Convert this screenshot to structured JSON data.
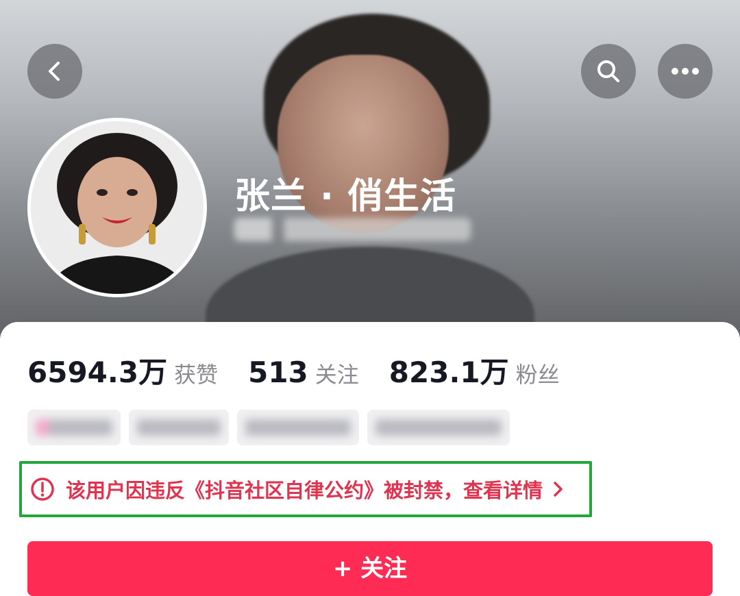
{
  "profile": {
    "name": "张兰 · 俏生活",
    "avatar_icon": "person-avatar"
  },
  "stats": [
    {
      "value": "6594.3万",
      "label": "获赞"
    },
    {
      "value": "513",
      "label": "关注"
    },
    {
      "value": "823.1万",
      "label": "粉丝"
    }
  ],
  "notice": {
    "text": "该用户因违反《抖音社区自律公约》被封禁，查看详情",
    "icon": "alert-circle-icon",
    "color": "#e0334f",
    "highlight_color": "#22a83a"
  },
  "actions": {
    "follow_label": "+ 关注"
  },
  "colors": {
    "accent": "#fe2c55",
    "text_primary": "#161823",
    "text_secondary": "#8a8b91"
  }
}
